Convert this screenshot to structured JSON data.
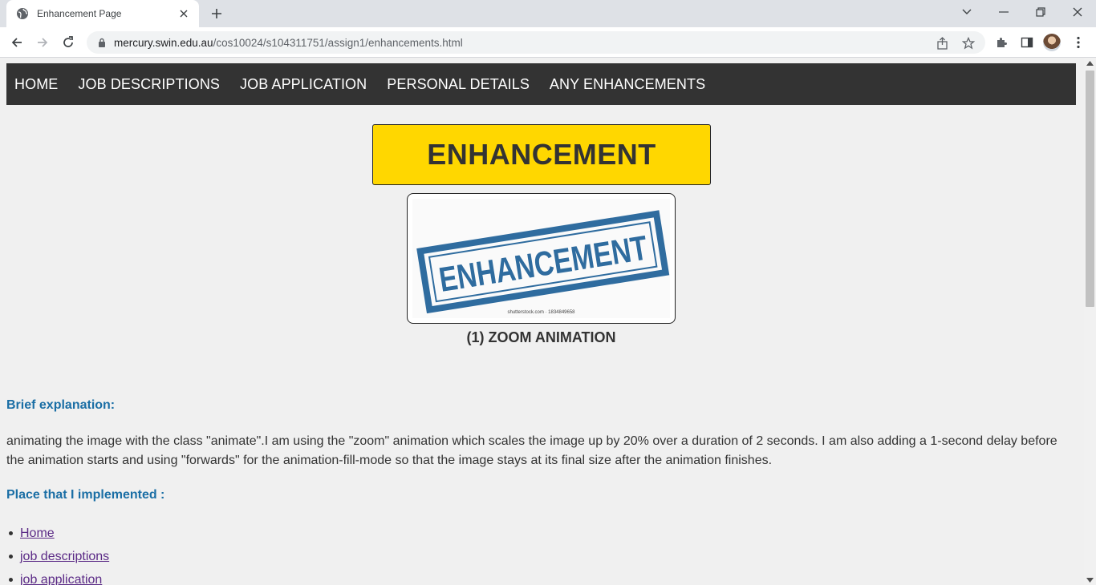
{
  "browser": {
    "tab_title": "Enhancement Page",
    "url_host": "mercury.swin.edu.au",
    "url_path": "/cos10024/s104311751/assign1/enhancements.html"
  },
  "nav": {
    "items": [
      {
        "label": "HOME"
      },
      {
        "label": "JOB DESCRIPTIONS"
      },
      {
        "label": "JOB APPLICATION"
      },
      {
        "label": "PERSONAL DETAILS"
      },
      {
        "label": "ANY ENHANCEMENTS"
      }
    ]
  },
  "banner": {
    "title": "ENHANCEMENT"
  },
  "image": {
    "stamp_text": "ENHANCEMENT",
    "credit": "shutterstock.com · 1834849658",
    "caption": "(1) ZOOM ANIMATION"
  },
  "content": {
    "explanation_heading": "Brief explanation:",
    "explanation_text": "animating the image with the class \"animate\".I am using the \"zoom\" animation which scales the image up by 20% over a duration of 2 seconds. I am also adding a 1-second delay before the animation starts and using \"forwards\" for the animation-fill-mode so that the image stays at its final size after the animation finishes.",
    "place_heading": "Place that I implemented :",
    "links": [
      {
        "label": "Home"
      },
      {
        "label": "job descriptions"
      },
      {
        "label": "job application"
      }
    ]
  },
  "colors": {
    "nav_bg": "#333333",
    "banner_bg": "#ffd700",
    "heading_blue": "#1a6ea5",
    "link_purple": "#5b2a86",
    "stamp_blue": "#2f6c9f"
  }
}
